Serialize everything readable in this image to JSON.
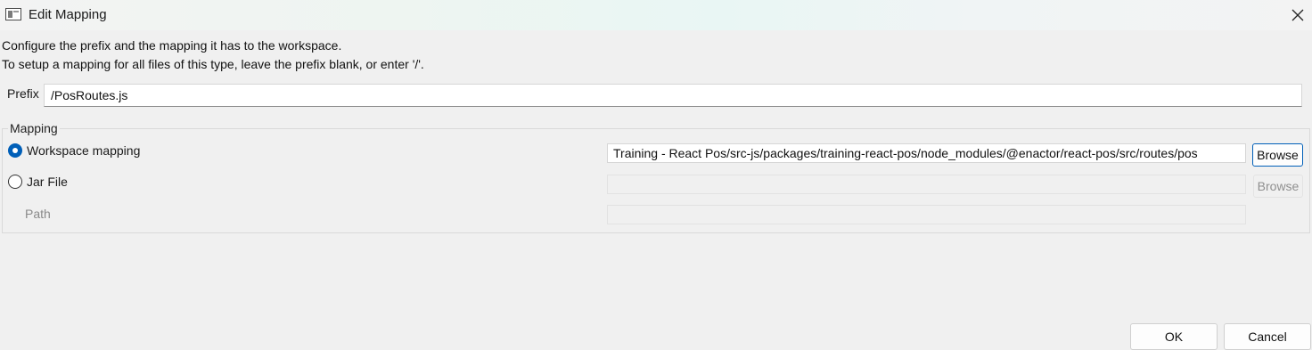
{
  "window": {
    "title": "Edit Mapping",
    "icon": "window-app-icon",
    "close_icon": "close-icon"
  },
  "description": {
    "line1": "Configure the prefix and the mapping it has to the workspace.",
    "line2": "To setup a mapping for all files of this type, leave the prefix blank, or enter '/'."
  },
  "prefix": {
    "label": "Prefix",
    "value": "/PosRoutes.js"
  },
  "mapping": {
    "group_label": "Mapping",
    "workspace": {
      "label": "Workspace mapping",
      "selected": true,
      "value": "Training - React Pos/src-js/packages/training-react-pos/node_modules/@enactor/react-pos/src/routes/pos",
      "browse_label": "Browse",
      "enabled": true
    },
    "jar": {
      "label": "Jar File",
      "selected": false,
      "value": "",
      "browse_label": "Browse",
      "enabled": false
    },
    "path": {
      "label": "Path",
      "value": "",
      "enabled": false
    }
  },
  "footer": {
    "ok_label": "OK",
    "cancel_label": "Cancel"
  },
  "colors": {
    "accent": "#005fb8",
    "background": "#f0f0f0",
    "disabled_text": "#8a8a8a"
  }
}
